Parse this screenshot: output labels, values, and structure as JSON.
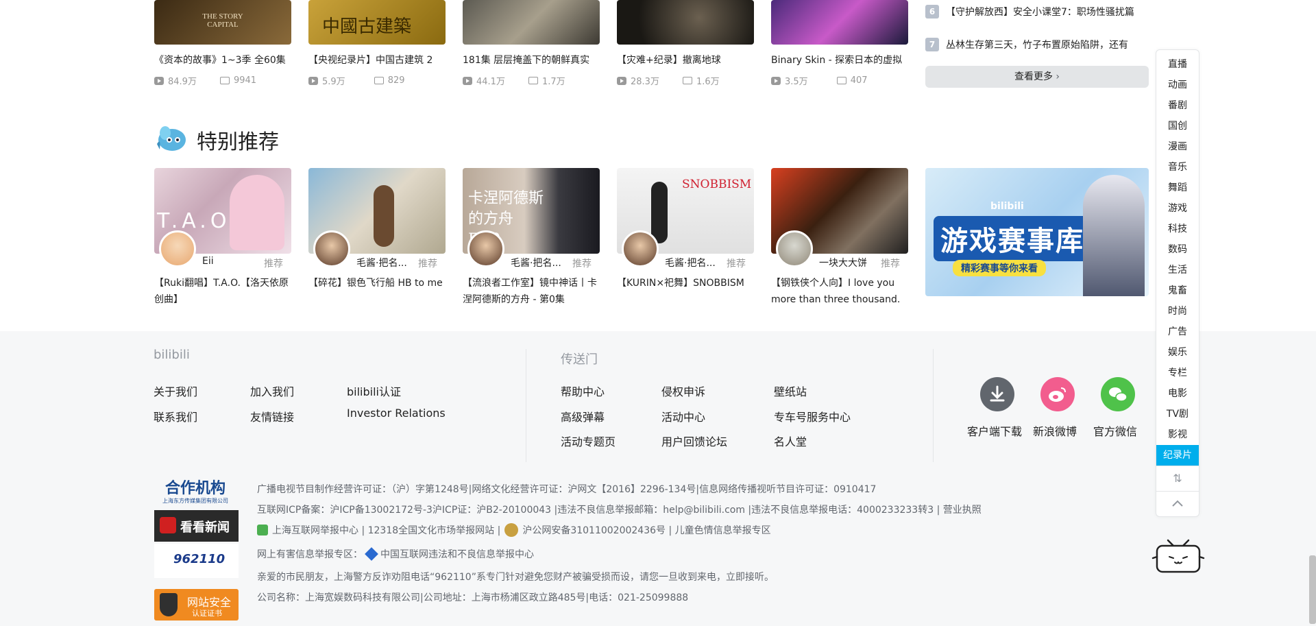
{
  "top_row": [
    {
      "title": "《资本的故事》1~3季 全60集",
      "views": "84.9万",
      "danmaku": "9941"
    },
    {
      "title": "【央视纪录片】中国古建筑 2",
      "views": "5.9万",
      "danmaku": "829"
    },
    {
      "title": "181集 层层掩盖下的朝鲜真实",
      "views": "44.1万",
      "danmaku": "1.7万"
    },
    {
      "title": "【灾难+纪录】撤离地球",
      "views": "28.3万",
      "danmaku": "1.6万"
    },
    {
      "title": "Binary Skin - 探索日本的虚拟",
      "views": "3.5万",
      "danmaku": "407"
    }
  ],
  "top_thumb_text": {
    "t1": "THE STORY CAPITAL",
    "t2": "中國古建築"
  },
  "ranking": [
    {
      "num": "6",
      "title": "【守护解放西】安全小课堂7：职场性骚扰篇"
    },
    {
      "num": "7",
      "title": "丛林生存第三天，竹子布置原始陷阱，还有"
    }
  ],
  "more_label": "查看更多",
  "section_title": "特别推荐",
  "featured": [
    {
      "up": "Eii",
      "rec": "推荐",
      "title": "【Ruki翻唱】T.A.O.【洛天依原创曲】",
      "thumb_text": "T.A.O"
    },
    {
      "up": "毛酱·把名...",
      "rec": "推荐",
      "title": "【碎花】银色飞行船 HB to me",
      "thumb_text": ""
    },
    {
      "up": "毛酱·把名...",
      "rec": "推荐",
      "title": "【流浪者工作室】镜中神话丨卡涅阿德斯的方舟 - 第0集",
      "thumb_text": "卡涅阿德斯的方舟 EP.0"
    },
    {
      "up": "毛酱·把名...",
      "rec": "推荐",
      "title": "【KURIN×祀舞】SNOBBISM",
      "thumb_text": "SNOBBISM"
    },
    {
      "up": "一块大大饼",
      "rec": "推荐",
      "title": "【钢铁侠个人向】I love you more than three thousand.",
      "thumb_text": ""
    }
  ],
  "banner": {
    "brand": "bilibili",
    "title": "游戏赛事库",
    "subtitle": "精彩赛事等你来看"
  },
  "footer": {
    "brand": "bilibili",
    "col1": [
      "关于我们",
      "加入我们",
      "bilibili认证",
      "联系我们",
      "友情链接",
      "Investor Relations"
    ],
    "portal_title": "传送门",
    "col2": [
      "帮助中心",
      "侵权申诉",
      "壁纸站",
      "高级弹幕",
      "活动中心",
      "专车号服务中心",
      "活动专题页",
      "用户回馈论坛",
      "名人堂"
    ],
    "social": [
      {
        "label": "客户端下载",
        "color": "#61666d"
      },
      {
        "label": "新浪微博",
        "color": "#f25d8e"
      },
      {
        "label": "官方微信",
        "color": "#4fc24a"
      }
    ],
    "partners": {
      "p1": "合作机构",
      "p1_sub": "上海东方传媒集团有限公司",
      "p2": "看看新闻",
      "p3": "962110",
      "p4": "网站安全",
      "p4_sub": "认证证书"
    },
    "info": [
      "广播电视节目制作经营许可证：（沪）字第1248号|网络文化经营许可证：沪网文【2016】2296-134号|信息网络传播视听节目许可证：0910417",
      "互联网ICP备案：沪ICP备13002172号-3沪ICP证：沪B2-20100043 |违法不良信息举报邮箱：help@bilibili.com |违法不良信息举报电话：4000233233转3 | 营业执照",
      "上海互联网举报中心 | 12318全国文化市场举报网站 |",
      "沪公网安备31011002002436号 | 儿童色情信息举报专区",
      "网上有害信息举报专区：",
      "中国互联网违法和不良信息举报中心",
      "亲爱的市民朋友，上海警方反诈劝阻电话“962110”系专门针对避免您财产被骗受损而设，请您一旦收到来电，立即接听。",
      "公司名称：上海宽娱数码科技有限公司|公司地址：上海市杨浦区政立路485号|电话：021-25099888"
    ]
  },
  "side_nav": [
    "直播",
    "动画",
    "番剧",
    "国创",
    "漫画",
    "音乐",
    "舞蹈",
    "游戏",
    "科技",
    "数码",
    "生活",
    "鬼畜",
    "时尚",
    "广告",
    "娱乐",
    "专栏",
    "电影",
    "TV剧",
    "影视",
    "纪录片"
  ],
  "side_nav_active": "纪录片"
}
